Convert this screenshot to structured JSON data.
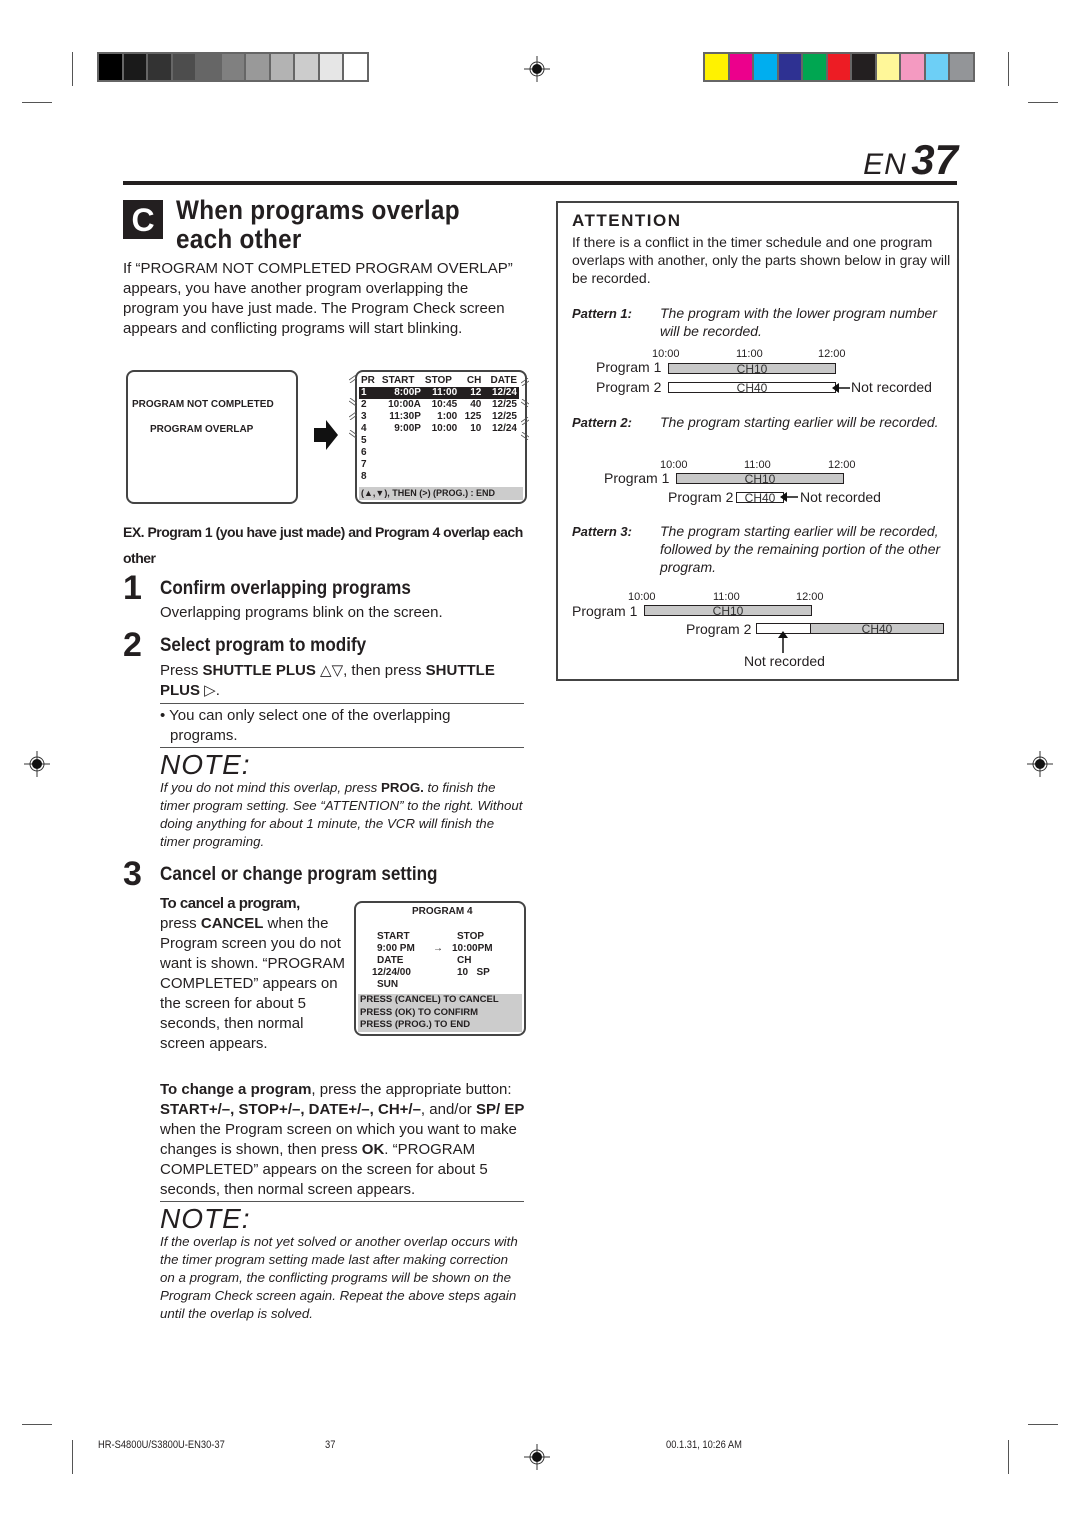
{
  "print_marks": {
    "gray_swatches": [
      "#000000",
      "#1a1a1a",
      "#333333",
      "#4d4d4d",
      "#666666",
      "#808080",
      "#999999",
      "#b3b3b3",
      "#cccccc",
      "#e6e6e6",
      "#ffffff"
    ],
    "color_swatches": [
      "#fff200",
      "#ec008c",
      "#00aeef",
      "#2e3192",
      "#00a651",
      "#ed1c24",
      "#231f20",
      "#fff799",
      "#f49ac1",
      "#6dcff6",
      "#939598"
    ]
  },
  "header": {
    "lang": "EN",
    "page_number": "37"
  },
  "section": {
    "letter": "C",
    "title": "When programs overlap each other",
    "intro": "If “PROGRAM NOT COMPLETED PROGRAM OVERLAP” appears, you have another program overlapping the program you have just made. The Program Check screen appears and conflicting programs will start blinking."
  },
  "screen_overlap": {
    "line1": "PROGRAM NOT COMPLETED",
    "line2": "PROGRAM OVERLAP"
  },
  "screen_check": {
    "headers": [
      "PR",
      "START",
      "STOP",
      "CH",
      "DATE"
    ],
    "rows": [
      [
        "1",
        "8:00P",
        "11:00",
        "12",
        "12/24"
      ],
      [
        "2",
        "10:00A",
        "10:45",
        "40",
        "12/25"
      ],
      [
        "3",
        "11:30P",
        "1:00",
        "125",
        "12/25"
      ],
      [
        "4",
        "9:00P",
        "10:00",
        "10",
        "12/24"
      ],
      [
        "5",
        "",
        "",
        "",
        ""
      ],
      [
        "6",
        "",
        "",
        "",
        ""
      ],
      [
        "7",
        "",
        "",
        "",
        ""
      ],
      [
        "8",
        "",
        "",
        "",
        ""
      ]
    ],
    "footer": "(▲,▼), THEN (>)  (PROG.) : END"
  },
  "example": "EX. Program 1 (you have just made) and Program 4 overlap each other",
  "steps": [
    {
      "num": "1",
      "title": "Confirm overlapping programs",
      "text": "Overlapping programs blink on the screen."
    },
    {
      "num": "2",
      "title": "Select program to modify",
      "text_pre": "Press ",
      "key1": "SHUTTLE PLUS",
      "text_mid": " △▽, then press ",
      "key2": "SHUTTLE PLUS",
      "text_post": " ▷.",
      "bullet": "• You can only select one of the overlapping programs."
    },
    {
      "num": "3",
      "title": "Cancel or change program setting"
    }
  ],
  "note1": {
    "heading": "NOTE:",
    "pre": "If you do not mind this overlap, press ",
    "key": "PROG.",
    "post": " to finish the timer program setting. See “ATTENTION” to the right. Without doing anything for about 1 minute, the VCR will finish the timer programing."
  },
  "cancel": {
    "lead": "To cancel a program,",
    "pre": "press ",
    "key": "CANCEL",
    "post": " when the Program screen you do not want is shown. “PROGRAM COMPLETED” appears on the screen for about 5 seconds, then normal screen appears."
  },
  "screen_program": {
    "title": "PROGRAM 4",
    "start_label": "START",
    "stop_label": "STOP",
    "start_value": "9:00 PM",
    "arrow": "→",
    "stop_value": "10:00PM",
    "date_label": "DATE",
    "ch_label": "CH",
    "date_value": "12/24/00",
    "ch_value": "10   SP",
    "day": "SUN",
    "footer": [
      "PRESS (CANCEL) TO CANCEL",
      "PRESS (OK) TO CONFIRM",
      "PRESS (PROG.) TO END"
    ]
  },
  "change": {
    "lead": "To change a program",
    "t1": ", press the appropriate button: ",
    "keys": "START+/–, STOP+/–, DATE+/–, CH+/–",
    "t2": ", and/or ",
    "key_sp": "SP/ EP",
    "t3": " when the Program screen on which you want to make changes is shown, then press ",
    "key_ok": "OK",
    "t4": ". “PROGRAM COMPLETED” appears on the screen for about 5 seconds, then normal screen appears."
  },
  "note2": {
    "heading": "NOTE:",
    "text": "If the overlap is not yet solved or another overlap occurs with the timer program setting made last after making correction on a program, the conflicting programs will be shown on the Program Check screen again. Repeat the above steps again until the overlap is solved."
  },
  "attention": {
    "heading": "ATTENTION",
    "text": "If there is a conflict in the timer schedule and one program overlaps with another, only the parts shown below in gray will be recorded.",
    "patterns": [
      {
        "label": "Pattern 1:",
        "text": "The program with the lower program number will be recorded.",
        "ticks": [
          "10:00",
          "11:00",
          "12:00"
        ],
        "prog1": "Program 1",
        "prog2": "Program 2",
        "ch1": "CH10",
        "ch2": "CH40",
        "not_recorded": "Not recorded"
      },
      {
        "label": "Pattern 2:",
        "text": "The program starting earlier will be recorded.",
        "ticks": [
          "10:00",
          "11:00",
          "12:00"
        ],
        "prog1": "Program 1",
        "prog2": "Program 2",
        "ch1": "CH10",
        "ch2": "CH40",
        "not_recorded": "Not recorded"
      },
      {
        "label": "Pattern 3:",
        "text": "The program starting earlier will be recorded, followed by the remaining portion of the other program.",
        "ticks": [
          "10:00",
          "11:00",
          "12:00"
        ],
        "prog1": "Program 1",
        "prog2": "Program 2",
        "ch1": "CH10",
        "ch2": "CH40",
        "not_recorded": "Not recorded"
      }
    ]
  },
  "footer": {
    "model": "HR-S4800U/S3800U-EN30-37",
    "page": "37",
    "timestamp": "00.1.31, 10:26 AM"
  }
}
